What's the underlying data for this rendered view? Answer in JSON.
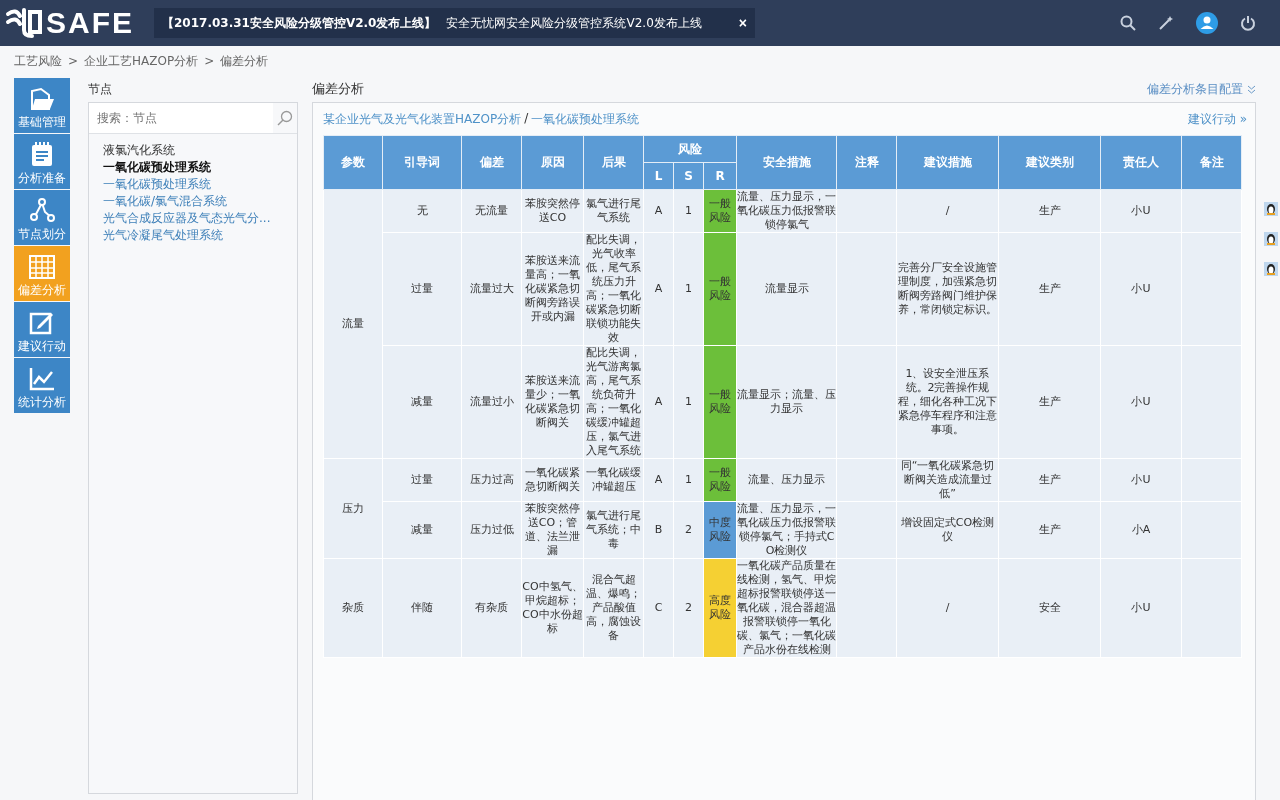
{
  "header": {
    "logo": "SAFE",
    "notice": {
      "title": "【2017.03.31安全风险分级管控V2.0发布上线】",
      "text": "安全无忧网安全风险分级管控系统V2.0发布上线",
      "close": "×"
    }
  },
  "breadcrumb": [
    "工艺风险",
    "企业工艺HAZOP分析",
    "偏差分析"
  ],
  "breadcrumb_separator": ">",
  "sidebar": [
    {
      "label": "基础管理",
      "kind": "folder",
      "selected": false
    },
    {
      "label": "分析准备",
      "kind": "notepad",
      "selected": false
    },
    {
      "label": "节点划分",
      "kind": "nodes",
      "selected": false
    },
    {
      "label": "偏差分析",
      "kind": "grid",
      "selected": true
    },
    {
      "label": "建议行动",
      "kind": "edit",
      "selected": false
    },
    {
      "label": "统计分析",
      "kind": "chart",
      "selected": false
    }
  ],
  "nodes_panel": {
    "title": "节点",
    "search_placeholder": "搜索：节点",
    "items": [
      {
        "label": "液氯汽化系统",
        "kind": "text",
        "selected": false
      },
      {
        "label": "一氧化碳预处理系统",
        "kind": "link",
        "selected": true
      },
      {
        "label": "一氧化碳预处理系统",
        "kind": "link",
        "selected": false
      },
      {
        "label": "一氧化碳/氯气混合系统",
        "kind": "link",
        "selected": false
      },
      {
        "label": "光气合成反应器及气态光气分...",
        "kind": "link",
        "selected": false
      },
      {
        "label": "光气冷凝尾气处理系统",
        "kind": "link",
        "selected": false
      }
    ]
  },
  "main": {
    "title": "偏差分析",
    "config_link": "偏差分析条目配置",
    "path": {
      "project": "某企业光气及光气化装置HAZOP分析",
      "separator": "/",
      "node": "一氧化碳预处理系统"
    },
    "action_link": "建议行动 »",
    "table": {
      "columns": [
        "参数",
        "引导词",
        "偏差",
        "原因",
        "后果",
        "风险",
        "安全措施",
        "注释",
        "建议措施",
        "建议类别",
        "责任人",
        "备注"
      ],
      "risk_subcolumns": [
        "L",
        "S",
        "R"
      ],
      "groups": [
        {
          "parameter": "流量",
          "rows": [
            {
              "guide": "无",
              "deviation": "无流量",
              "cause": "苯胺突然停送CO",
              "consequence": "氯气进行尾气系统",
              "l": "A",
              "s": "1",
              "risk": "一般风险",
              "color": "#6cbf3a",
              "safety": "流量、压力显示，一氧化碳压力低报警联锁停氯气",
              "suggestion": "/",
              "category": "生产",
              "owner": "小U"
            },
            {
              "guide": "过量",
              "deviation": "流量过大",
              "cause": "苯胺送来流量高；一氧化碳紧急切断阀旁路误开或内漏",
              "consequence": "配比失调，光气收率低，尾气系统压力升高；一氧化碳紧急切断联锁功能失效",
              "l": "A",
              "s": "1",
              "risk": "一般风险",
              "color": "#6cbf3a",
              "safety": "流量显示",
              "suggestion": "完善分厂安全设施管理制度，加强紧急切断阀旁路阀门维护保养，常闭锁定标识。",
              "category": "生产",
              "owner": "小U"
            },
            {
              "guide": "减量",
              "deviation": "流量过小",
              "cause": "苯胺送来流量少；一氧化碳紧急切断阀关",
              "consequence": "配比失调，光气游离氯高，尾气系统负荷升高；一氧化碳缓冲罐超压，氯气进入尾气系统",
              "l": "A",
              "s": "1",
              "risk": "一般风险",
              "color": "#6cbf3a",
              "safety": "流量显示；流量、压力显示",
              "suggestion": "1、设安全泄压系统。2完善操作规程，细化各种工况下紧急停车程序和注意事项。",
              "category": "生产",
              "owner": "小U"
            }
          ]
        },
        {
          "parameter": "压力",
          "rows": [
            {
              "guide": "过量",
              "deviation": "压力过高",
              "cause": "一氧化碳紧急切断阀关",
              "consequence": "一氧化碳缓冲罐超压",
              "l": "A",
              "s": "1",
              "risk": "一般风险",
              "color": "#6cbf3a",
              "safety": "流量、压力显示",
              "suggestion": "同“一氧化碳紧急切断阀关造成流量过低”",
              "category": "生产",
              "owner": "小U"
            },
            {
              "guide": "减量",
              "deviation": "压力过低",
              "cause": "苯胺突然停送CO；管道、法兰泄漏",
              "consequence": "氯气进行尾气系统；中毒",
              "l": "B",
              "s": "2",
              "risk": "中度风险",
              "color": "#5b9bd5",
              "safety": "流量、压力显示，一氧化碳压力低报警联锁停氯气；手持式CO检测仪",
              "suggestion": "增设固定式CO检测仪",
              "category": "生产",
              "owner": "小A"
            }
          ]
        },
        {
          "parameter": "杂质",
          "rows": [
            {
              "guide": "伴随",
              "deviation": "有杂质",
              "cause": "CO中氢气、甲烷超标；CO中水份超标",
              "consequence": "混合气超温、爆鸣；产品酸值高，腐蚀设备",
              "l": "C",
              "s": "2",
              "risk": "高度风险",
              "color": "#f5d033",
              "safety": "一氧化碳产品质量在线检测，氢气、甲烷超标报警联锁停送一氧化碳，混合器超温报警联锁停一氧化碳、氯气；一氧化碳产品水份在线检测",
              "suggestion": "/",
              "category": "安全",
              "owner": "小U"
            }
          ]
        }
      ]
    }
  },
  "side_contacts": [
    {
      "kind": "penguin"
    },
    {
      "kind": "penguin"
    },
    {
      "kind": "penguin"
    }
  ]
}
